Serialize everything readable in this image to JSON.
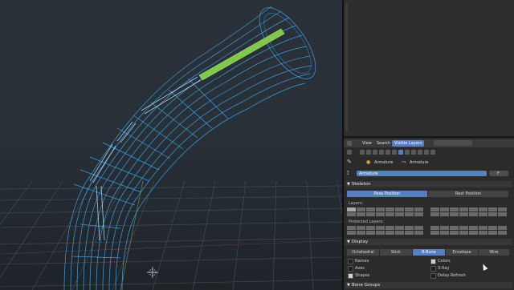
{
  "header": {
    "menu_view": "View",
    "menu_search": "Search",
    "filter_select": "Visible Layers"
  },
  "context": {
    "crumb_1": "Armature",
    "crumb_2": "Armature",
    "datablock_name": "Armature",
    "users_count": "F"
  },
  "skeleton": {
    "title": "Skeleton",
    "pose_position": "Pose Position",
    "rest_position": "Rest Position",
    "layers_label": "Layers:",
    "protected_layers_label": "Protected Layers:"
  },
  "display": {
    "title": "Display",
    "modes": [
      "Octahedral",
      "Stick",
      "B-Bone",
      "Envelope",
      "Wire"
    ],
    "active_mode": "B-Bone",
    "options": {
      "names": "Names",
      "axes": "Axes",
      "shapes": "Shapes",
      "colors": "Colors",
      "xray": "X-Ray",
      "delay_refresh": "Delay Refresh"
    }
  },
  "bone_groups": {
    "title": "Bone Groups"
  },
  "colors": {
    "accent": "#5680c2",
    "wireframe": "#3aa7e8",
    "selected_bone": "#7ec84a"
  },
  "icons": [
    "panel-menu-icon",
    "armature-data-icon",
    "pin-icon",
    "bone-icon",
    "cursor-icon"
  ]
}
